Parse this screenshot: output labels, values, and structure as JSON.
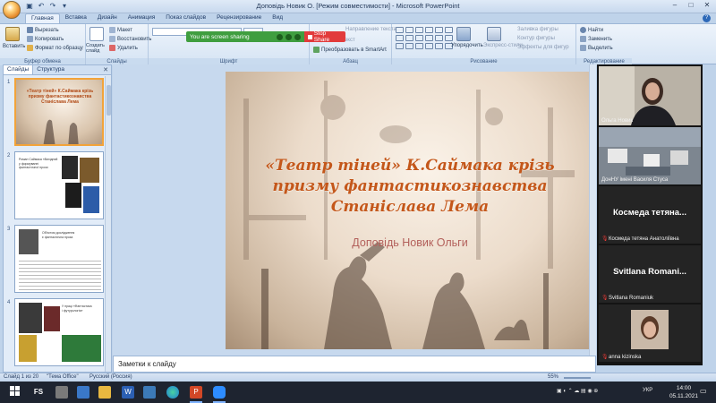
{
  "window": {
    "title": "Доповідь Новик О. [Режим совместимости] - Microsoft PowerPoint",
    "min": "–",
    "max": "□",
    "close": "✕"
  },
  "ribbon_tabs": [
    "Главная",
    "Вставка",
    "Дизайн",
    "Анимация",
    "Показ слайдов",
    "Рецензирование",
    "Вид"
  ],
  "ribbon": {
    "clipboard": {
      "paste": "Вставить",
      "cut": "Вырезать",
      "copy": "Копировать",
      "format": "Формат по образцу",
      "label": "Буфер обмена"
    },
    "slides": {
      "new": "Создать слайд",
      "layout": "Макет",
      "reset": "Восстановить",
      "delete": "Удалить",
      "label": "Слайды"
    },
    "font": {
      "label": "Шрифт"
    },
    "paragraph": {
      "direction": "Направление текста",
      "align": "Выровнять текст",
      "smartart": "Преобразовать в SmartArt",
      "label": "Абзац"
    },
    "drawing": {
      "arrange": "Упорядочить",
      "styles": "Экспресс-стили",
      "fill": "Заливка фигуры",
      "outline": "Контур фигуры",
      "effects": "Эффекты для фигур",
      "label": "Рисование"
    },
    "editing": {
      "find": "Найти",
      "replace": "Заменить",
      "select": "Выделить",
      "label": "Редактирование"
    }
  },
  "share": {
    "status": "You are screen sharing",
    "stop": "Stop Share"
  },
  "left_panel": {
    "tab_slides": "Слайды",
    "tab_outline": "Структура",
    "close": "✕"
  },
  "thumbnails": [
    {
      "num": "1",
      "lines": [
        "«Театр тіней» К.Саймака крізь",
        "призму фантастикознавства",
        "Станіслава Лема"
      ]
    },
    {
      "num": "2",
      "lines": [
        "Роман Саймака «Вихідний",
        "у формуванні",
        "фантастичної прози"
      ]
    },
    {
      "num": "3",
      "lines": [
        "Об'єктом дослідження",
        "є фантастична проза"
      ]
    },
    {
      "num": "4",
      "lines": [
        "У праці «Фантастика",
        "і футурологія»"
      ]
    }
  ],
  "slide": {
    "title": "«Театр тіней» К.Саймака крізь призму фантастикознавства Станіслава Лема",
    "subtitle": "Доповідь Новик Ольги"
  },
  "notes": {
    "placeholder": "Заметки к слайду"
  },
  "status": {
    "slide": "Слайд 1 из 20",
    "theme": "\"Тема Office\"",
    "lang": "Русский (Россия)",
    "zoom": "55%"
  },
  "participants": [
    {
      "name": "Ольга Новик",
      "type": "video"
    },
    {
      "name": "ДонНУ імені Василя Стуса",
      "type": "video"
    },
    {
      "display": "Космеда  тетяна...",
      "name": "Космеда тетяна Анатоліївна",
      "type": "name",
      "muted": true
    },
    {
      "display": "Svitlana  Romani...",
      "name": "Svitlana Romaniuk",
      "type": "name",
      "muted": true
    },
    {
      "name": "anna kizinska",
      "type": "video",
      "muted": true
    }
  ],
  "taskbar": {
    "fs_label": "FS",
    "tray_lang": "УКР",
    "time": "14:00",
    "date": "05.11.2021"
  },
  "colors": {
    "accent_orange": "#c4571a",
    "share_green": "#3f9e3f",
    "share_red": "#e23b3b"
  }
}
